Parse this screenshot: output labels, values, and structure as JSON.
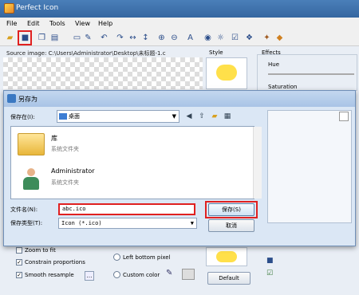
{
  "app": {
    "title": "Perfect Icon",
    "menus": [
      "File",
      "Edit",
      "Tools",
      "View",
      "Help"
    ],
    "source_label": "Source image: C:\\Users\\Administrator\\Desktop\\未标题-1.c",
    "style_label": "Style",
    "effects": {
      "title": "Effects",
      "hue": "Hue",
      "saturation": "Saturation"
    },
    "options": {
      "zoom_to_fit": "Zoom to fit",
      "constrain_proportions": "Constrain proportions",
      "smooth_resample": "Smooth resample",
      "left_bottom_pixel": "Left bottom pixel",
      "custom_color": "Custom color",
      "default_button": "Default"
    }
  },
  "dialog": {
    "title": "另存为",
    "save_in_label": "保存在(I):",
    "save_in_value": "桌面",
    "files": [
      {
        "name": "库",
        "type": "系统文件夹"
      },
      {
        "name": "Administrator",
        "type": "系统文件夹"
      }
    ],
    "filename_label": "文件名(N):",
    "filename_value": "abc.ico",
    "filetype_label": "保存类型(T):",
    "filetype_value": "Icon (*.ico)",
    "save_button": "保存(S)",
    "cancel_button": "取消"
  }
}
